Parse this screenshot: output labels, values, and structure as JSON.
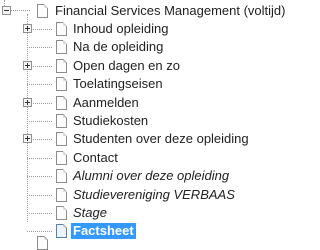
{
  "tree": {
    "root_label": "Financial Services Management (voltijd)",
    "items": [
      {
        "label": "Inhoud opleiding",
        "expandable": true,
        "italic": false,
        "selected": false
      },
      {
        "label": "Na de opleiding",
        "expandable": false,
        "italic": false,
        "selected": false
      },
      {
        "label": "Open dagen en zo",
        "expandable": true,
        "italic": false,
        "selected": false
      },
      {
        "label": "Toelatingseisen",
        "expandable": false,
        "italic": false,
        "selected": false
      },
      {
        "label": "Aanmelden",
        "expandable": true,
        "italic": false,
        "selected": false
      },
      {
        "label": "Studiekosten",
        "expandable": false,
        "italic": false,
        "selected": false
      },
      {
        "label": "Studenten over deze opleiding",
        "expandable": true,
        "italic": false,
        "selected": false
      },
      {
        "label": "Contact",
        "expandable": false,
        "italic": false,
        "selected": false
      },
      {
        "label": "Alumni over deze opleiding",
        "expandable": false,
        "italic": true,
        "selected": false
      },
      {
        "label": "Studievereniging VERBAAS",
        "expandable": false,
        "italic": true,
        "selected": false
      },
      {
        "label": "Stage",
        "expandable": false,
        "italic": true,
        "selected": false
      },
      {
        "label": "Factsheet",
        "expandable": false,
        "italic": false,
        "selected": true
      }
    ]
  },
  "colors": {
    "selection_bg": "#3399ff",
    "selection_text": "#ffffff",
    "text": "#222222",
    "guide_lines": "#9a9a9a"
  }
}
